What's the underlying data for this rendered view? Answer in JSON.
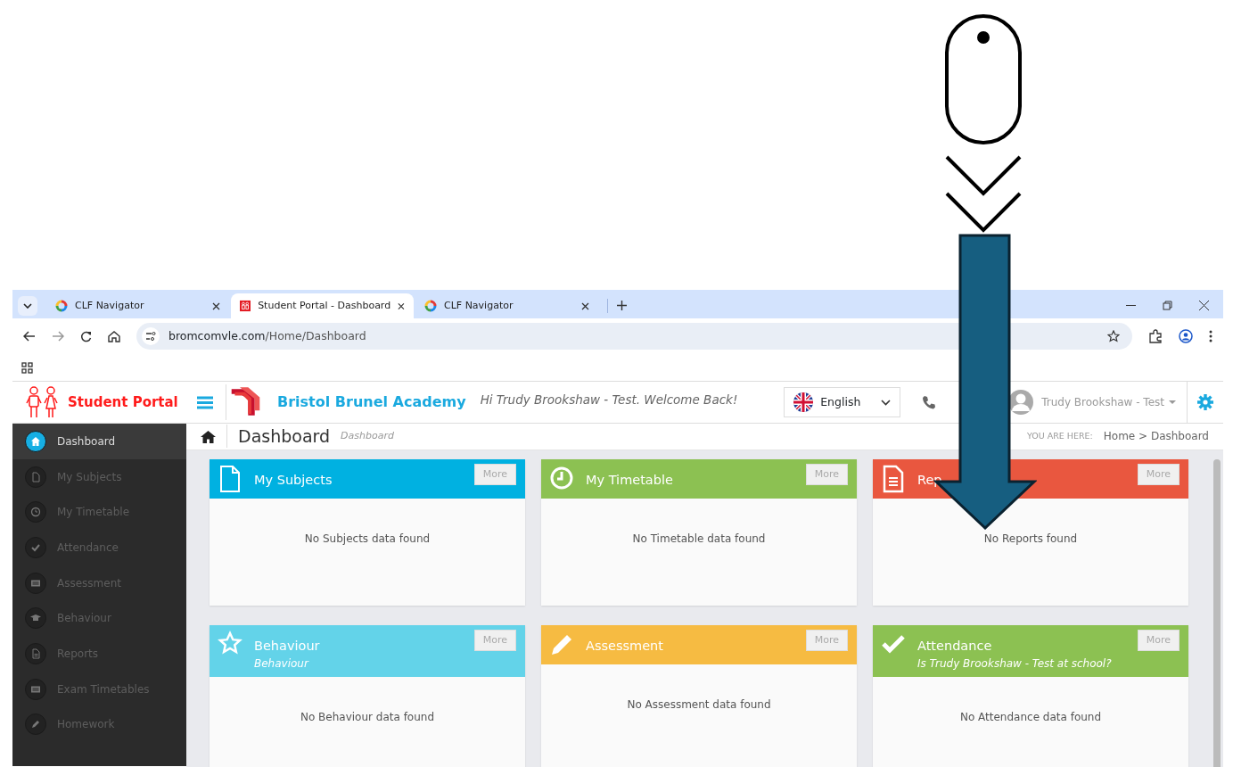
{
  "browser": {
    "tabs": [
      {
        "title": "CLF Navigator",
        "selected": false,
        "kind": "navigator"
      },
      {
        "title": "Student Portal - Dashboard",
        "selected": true,
        "kind": "portal"
      },
      {
        "title": "CLF Navigator",
        "selected": false,
        "kind": "navigator"
      }
    ],
    "url_host": "bromcomvle.com",
    "url_path": "/Home/Dashboard"
  },
  "header": {
    "brand": "Student Portal",
    "school": "Bristol Brunel Academy",
    "greeting": "Hi Trudy Brookshaw - Test. Welcome Back!",
    "language": "English",
    "user": "Trudy Brookshaw - Test"
  },
  "page": {
    "title": "Dashboard",
    "subtitle": "Dashboard",
    "you_are_here": "YOU ARE HERE:",
    "breadcrumb": "Home > Dashboard"
  },
  "sidebar": {
    "items": [
      {
        "label": "Dashboard",
        "selected": true
      },
      {
        "label": "My Subjects",
        "selected": false
      },
      {
        "label": "My Timetable",
        "selected": false
      },
      {
        "label": "Attendance",
        "selected": false
      },
      {
        "label": "Assessment",
        "selected": false
      },
      {
        "label": "Behaviour",
        "selected": false
      },
      {
        "label": "Reports",
        "selected": false
      },
      {
        "label": "Exam Timetables",
        "selected": false
      },
      {
        "label": "Homework",
        "selected": false
      }
    ]
  },
  "cards": [
    {
      "title": "My Subjects",
      "color": "#00b1e1",
      "button": "More",
      "message": "No Subjects data found"
    },
    {
      "title": "My Timetable",
      "color": "#8cc152",
      "button": "More",
      "message": "No Timetable data found"
    },
    {
      "title": "Rep",
      "color": "#e9573f",
      "button": "More",
      "message": "No Reports found"
    },
    {
      "title": "Behaviour",
      "subtitle": "Behaviour",
      "color": "#63d3e9",
      "button": "More",
      "message": "No Behaviour data found"
    },
    {
      "title": "Assessment",
      "color": "#f6bb42",
      "button": "More",
      "message": "No Assessment data found"
    },
    {
      "title": "Attendance",
      "subtitle": "Is Trudy Brookshaw - Test at school?",
      "color": "#8cc152",
      "button": "More",
      "message": "No Attendance data found"
    }
  ]
}
